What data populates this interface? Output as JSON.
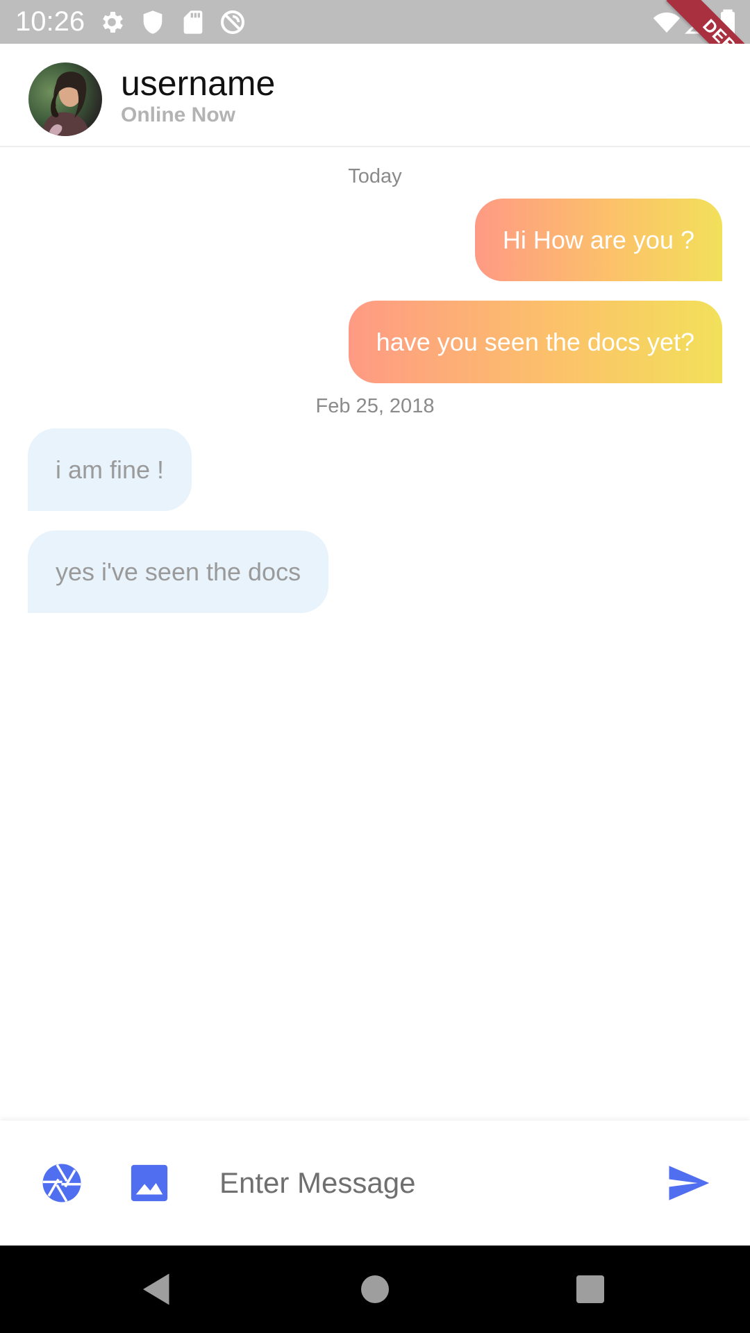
{
  "status_bar": {
    "time": "10:26",
    "icons": [
      "settings-icon",
      "shield-icon",
      "sd-card-icon",
      "do-not-disturb-icon",
      "wifi-icon",
      "signal-icon",
      "battery-icon"
    ]
  },
  "debug_banner": {
    "label": "DEBUG",
    "color": "#a8303f"
  },
  "header": {
    "title": "username",
    "subtitle": "Online Now"
  },
  "messages": [
    {
      "type": "date",
      "text": "Today"
    },
    {
      "type": "outgoing",
      "text": "Hi How are you ?"
    },
    {
      "type": "outgoing",
      "text": "have you seen the docs yet?"
    },
    {
      "type": "date",
      "text": "Feb 25, 2018"
    },
    {
      "type": "incoming",
      "text": "i am fine !"
    },
    {
      "type": "incoming",
      "text": "yes i've seen the docs"
    }
  ],
  "input": {
    "placeholder": "Enter Message",
    "value": ""
  },
  "actions": {
    "camera_icon": "camera-icon",
    "gallery_icon": "image-icon",
    "send_icon": "send-icon"
  },
  "nav": [
    "back-icon",
    "home-icon",
    "recents-icon"
  ],
  "colors": {
    "accent": "#4f6ef0",
    "outgoing_gradient": [
      "#fe9a84",
      "#fcc16a",
      "#f2e05a"
    ],
    "incoming_bubble": "#e8f3fc",
    "status_bar": "#bdbdbd"
  }
}
